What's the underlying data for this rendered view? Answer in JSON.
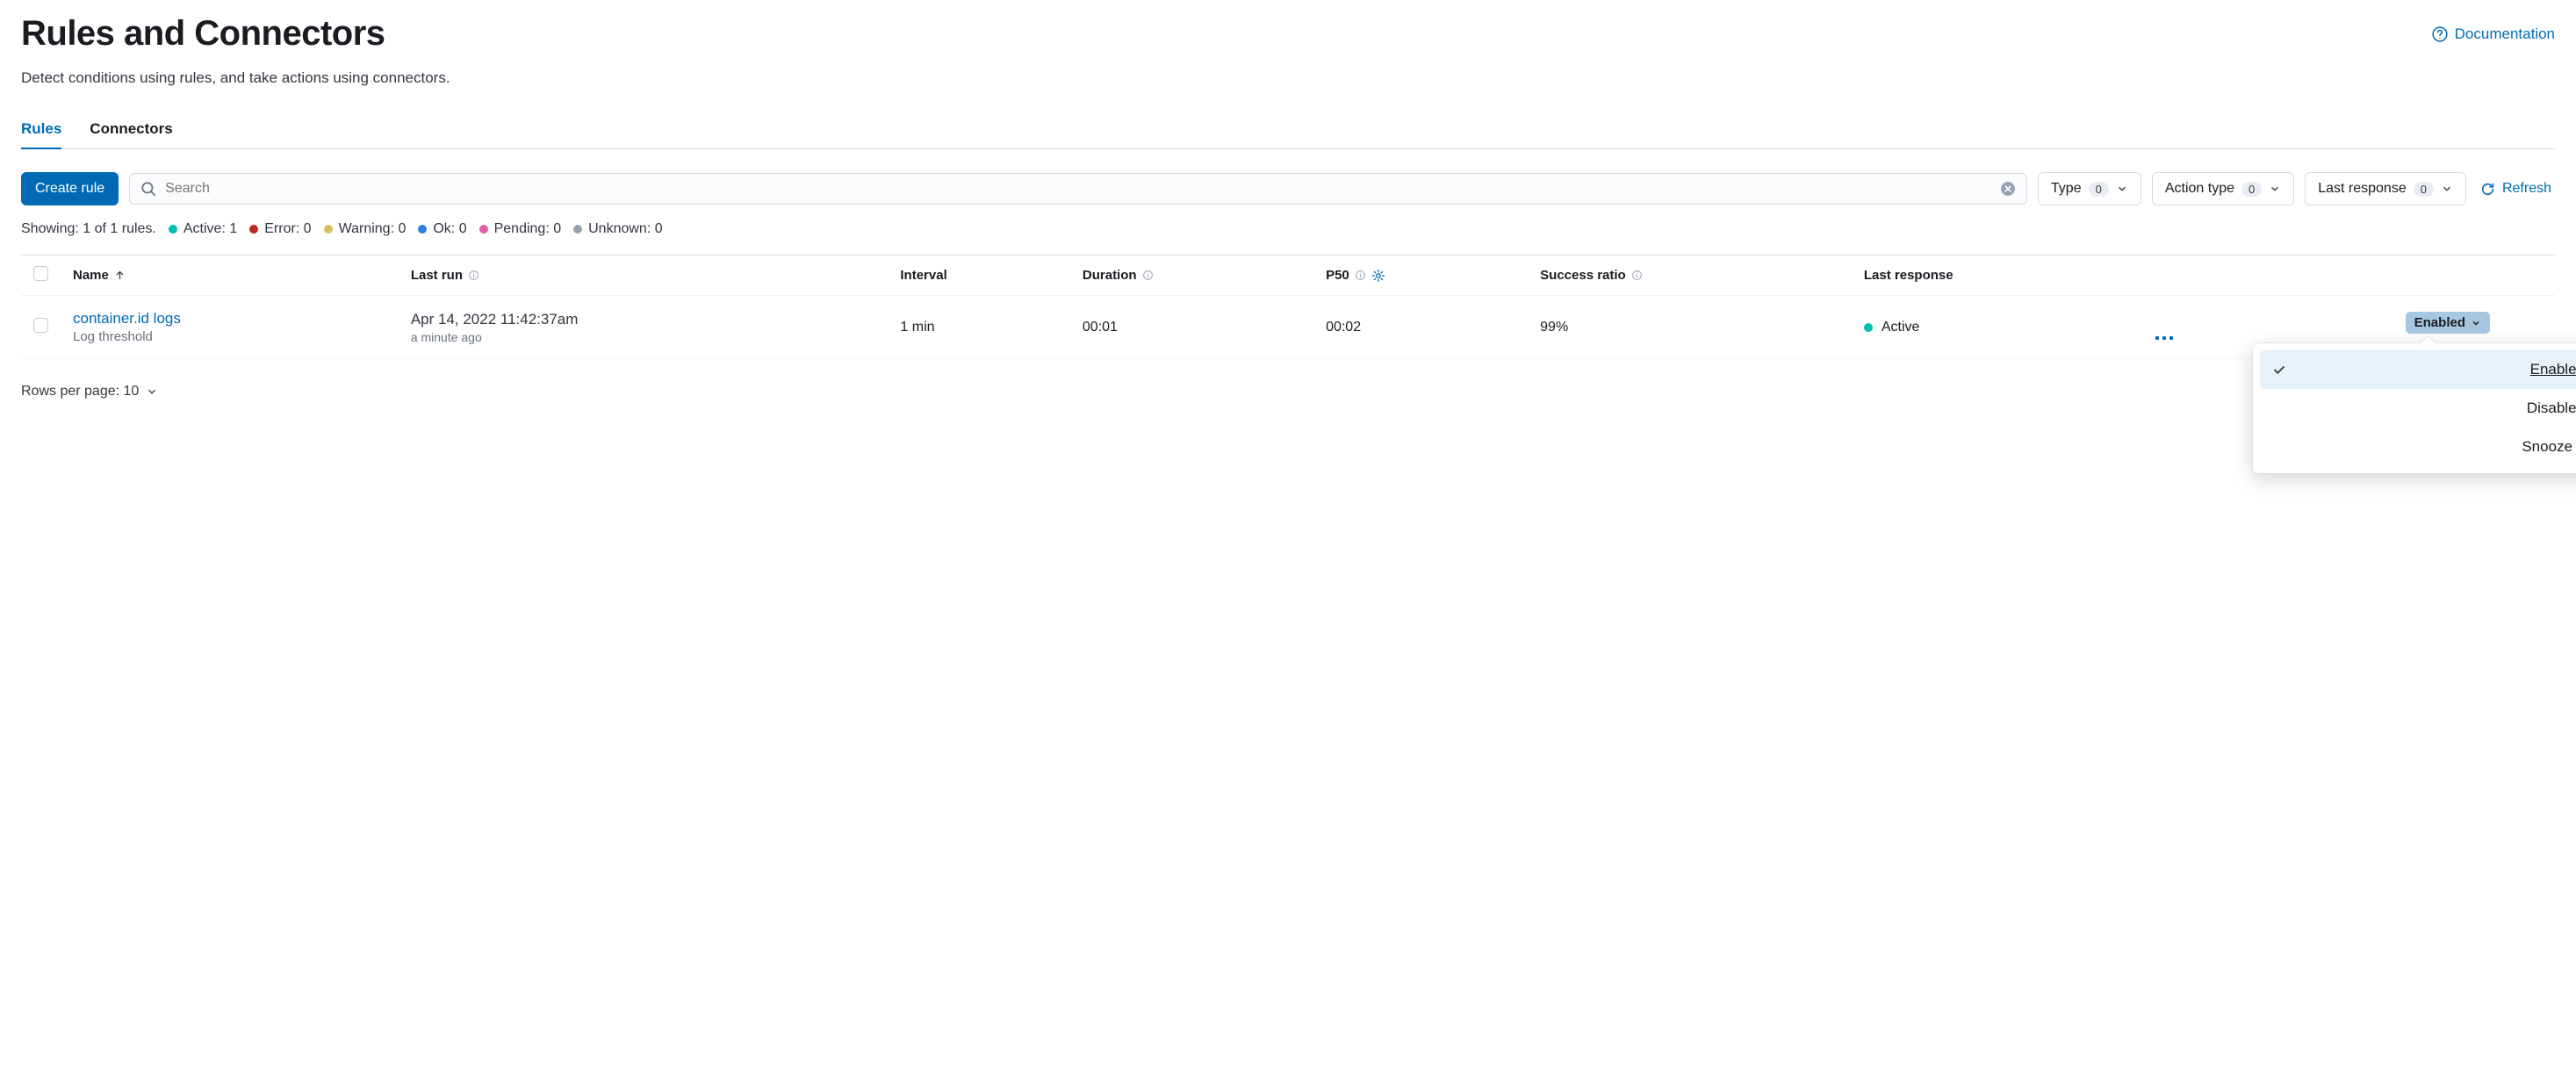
{
  "header": {
    "title": "Rules and Connectors",
    "doc_link": "Documentation",
    "subtitle": "Detect conditions using rules, and take actions using connectors."
  },
  "tabs": {
    "rules": "Rules",
    "connectors": "Connectors"
  },
  "toolbar": {
    "create_label": "Create rule",
    "search_placeholder": "Search"
  },
  "filters": {
    "type": {
      "label": "Type",
      "count": "0"
    },
    "action_type": {
      "label": "Action type",
      "count": "0"
    },
    "last_response": {
      "label": "Last response",
      "count": "0"
    },
    "refresh": "Refresh"
  },
  "summary": {
    "showing": "Showing: 1 of 1 rules.",
    "items": [
      {
        "color": "#00bfb3",
        "label": "Active: 1"
      },
      {
        "color": "#bd271e",
        "label": "Error: 0"
      },
      {
        "color": "#d6bf57",
        "label": "Warning: 0"
      },
      {
        "color": "#2f7de1",
        "label": "Ok: 0"
      },
      {
        "color": "#e65ca8",
        "label": "Pending: 0"
      },
      {
        "color": "#98a2b3",
        "label": "Unknown: 0"
      }
    ]
  },
  "columns": {
    "name": "Name",
    "last_run": "Last run",
    "interval": "Interval",
    "duration": "Duration",
    "p50": "P50",
    "success_ratio": "Success ratio",
    "last_response": "Last response"
  },
  "rows": [
    {
      "name": "container.id logs",
      "subtype": "Log threshold",
      "last_run_line1": "Apr 14, 2022 11:42:37am",
      "last_run_line2": "a minute ago",
      "interval": "1 min",
      "duration": "00:01",
      "p50": "00:02",
      "success_ratio": "99%",
      "last_response": "Active",
      "last_response_color": "#00bfb3",
      "status_label": "Enabled"
    }
  ],
  "status_popover": {
    "enabled": "Enabled",
    "disabled": "Disabled",
    "snooze": "Snooze"
  },
  "pagination": {
    "label": "Rows per page: 10"
  }
}
